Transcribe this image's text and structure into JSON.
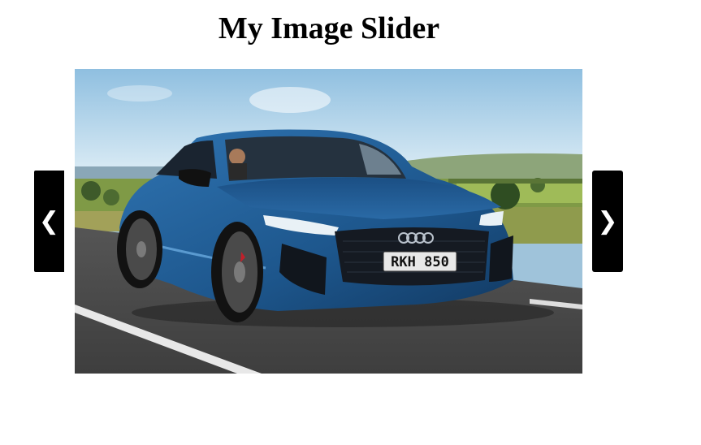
{
  "page": {
    "title": "My Image Slider"
  },
  "slider": {
    "prev_label": "❮",
    "next_label": "❯",
    "current_slide": {
      "description_icon": "car-photo",
      "license_plate": "RKH 850"
    }
  },
  "colors": {
    "button_bg": "#000000",
    "button_fg": "#ffffff",
    "car_body": "#1f5a8f"
  }
}
